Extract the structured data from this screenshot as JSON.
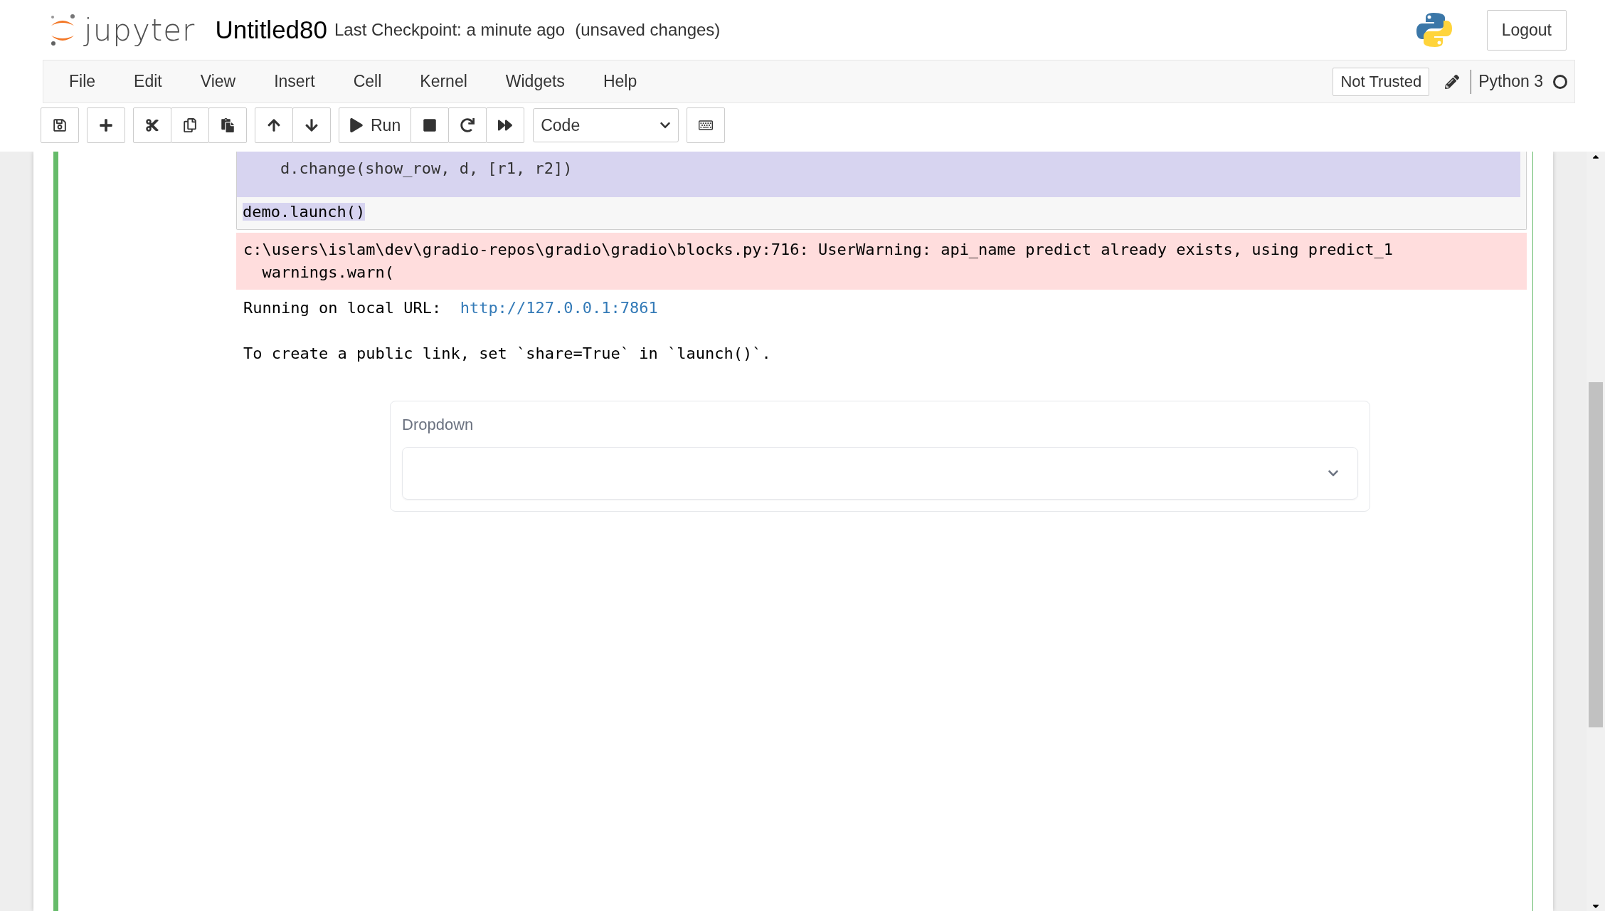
{
  "header": {
    "logo_text": "jupyter",
    "notebook_name": "Untitled80",
    "checkpoint": "Last Checkpoint: a minute ago",
    "save_status": "(unsaved changes)",
    "logout": "Logout"
  },
  "menu": [
    "File",
    "Edit",
    "View",
    "Insert",
    "Cell",
    "Kernel",
    "Widgets",
    "Help"
  ],
  "trust": "Not Trusted",
  "kernel": {
    "name": "Python 3",
    "busy": false
  },
  "toolbar": {
    "run": "Run",
    "cell_type": "Code"
  },
  "cell": {
    "editing": true,
    "code_lines": [
      {
        "text": "    d.change(show_row, d, [r1, r2])",
        "selected": true
      },
      {
        "text": "demo.launch()",
        "selected": true
      }
    ],
    "stderr": [
      "c:\\users\\islam\\dev\\gradio-repos\\gradio\\gradio\\blocks.py:716: UserWarning: api_name predict already exists, using predict_1",
      "  warnings.warn("
    ],
    "stdout": [
      {
        "text": "Running on local URL:  ",
        "link": "http://127.0.0.1:7861"
      },
      {
        "text": "To create a public link, set `share=True` in `launch()`."
      }
    ],
    "app": {
      "label": "Dropdown"
    }
  }
}
